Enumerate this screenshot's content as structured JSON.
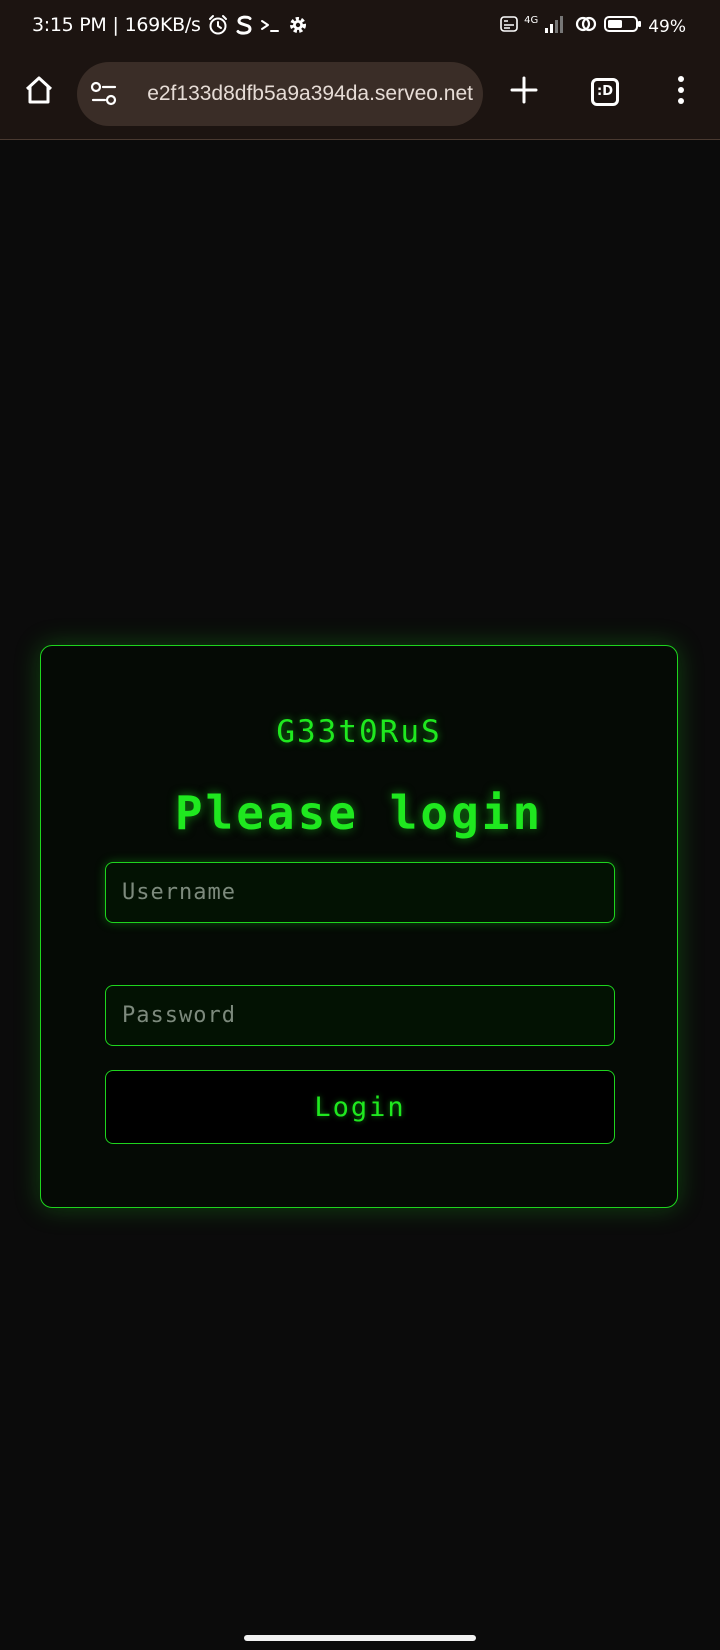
{
  "status_bar": {
    "time": "3:15 PM",
    "network_speed": "169KB/s",
    "battery_percent": "49%",
    "network_type": "4G",
    "icons": [
      "alarm-icon",
      "s-app-icon",
      "terminal-icon",
      "settings-icon",
      "volte-icon",
      "signal-icon",
      "link-icon",
      "battery-icon"
    ]
  },
  "browser": {
    "url": "e2f133d8dfb5a9a394da.serveo.net",
    "tab_switcher_label": ":D",
    "icons": [
      "home-icon",
      "site-settings-icon",
      "new-tab-icon",
      "tab-switcher-icon",
      "more-menu-icon"
    ]
  },
  "login": {
    "brand": "G33t0RuS",
    "heading": "Please login",
    "username_placeholder": "Username",
    "password_placeholder": "Password",
    "button_label": "Login"
  },
  "colors": {
    "accent": "#1fe81f",
    "page_background": "#0b0b0b",
    "browser_chrome": "#1c1411",
    "address_bar": "#3a2d27"
  }
}
